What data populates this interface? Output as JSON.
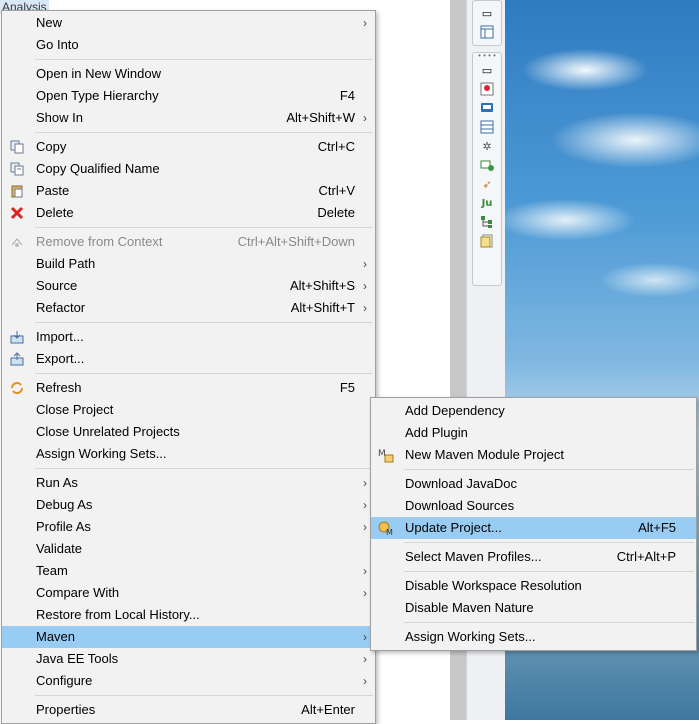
{
  "header": {
    "label": "Analysis"
  },
  "context_menu": {
    "items": [
      {
        "label": "New",
        "arrow": true
      },
      {
        "label": "Go Into"
      },
      {
        "sep": true
      },
      {
        "label": "Open in New Window"
      },
      {
        "label": "Open Type Hierarchy",
        "shortcut": "F4"
      },
      {
        "label": "Show In",
        "shortcut": "Alt+Shift+W",
        "arrow": true
      },
      {
        "sep": true
      },
      {
        "label": "Copy",
        "shortcut": "Ctrl+C",
        "icon": "copy-icon"
      },
      {
        "label": "Copy Qualified Name",
        "icon": "copy-qualified-name-icon"
      },
      {
        "label": "Paste",
        "shortcut": "Ctrl+V",
        "icon": "paste-icon"
      },
      {
        "label": "Delete",
        "shortcut": "Delete",
        "icon": "delete-icon"
      },
      {
        "sep": true
      },
      {
        "label": "Remove from Context",
        "shortcut": "Ctrl+Alt+Shift+Down",
        "icon": "remove-context-icon",
        "disabled": true
      },
      {
        "label": "Build Path",
        "arrow": true
      },
      {
        "label": "Source",
        "shortcut": "Alt+Shift+S",
        "arrow": true
      },
      {
        "label": "Refactor",
        "shortcut": "Alt+Shift+T",
        "arrow": true
      },
      {
        "sep": true
      },
      {
        "label": "Import...",
        "icon": "import-icon"
      },
      {
        "label": "Export...",
        "icon": "export-icon"
      },
      {
        "sep": true
      },
      {
        "label": "Refresh",
        "shortcut": "F5",
        "icon": "refresh-icon"
      },
      {
        "label": "Close Project"
      },
      {
        "label": "Close Unrelated Projects"
      },
      {
        "label": "Assign Working Sets..."
      },
      {
        "sep": true
      },
      {
        "label": "Run As",
        "arrow": true
      },
      {
        "label": "Debug As",
        "arrow": true
      },
      {
        "label": "Profile As",
        "arrow": true
      },
      {
        "label": "Validate"
      },
      {
        "label": "Team",
        "arrow": true
      },
      {
        "label": "Compare With",
        "arrow": true
      },
      {
        "label": "Restore from Local History..."
      },
      {
        "label": "Maven",
        "arrow": true,
        "highlighted": true
      },
      {
        "label": "Java EE Tools",
        "arrow": true
      },
      {
        "label": "Configure",
        "arrow": true
      },
      {
        "sep": true
      },
      {
        "label": "Properties",
        "shortcut": "Alt+Enter"
      }
    ]
  },
  "maven_submenu": {
    "items": [
      {
        "label": "Add Dependency"
      },
      {
        "label": "Add Plugin"
      },
      {
        "label": "New Maven Module Project",
        "icon": "maven-module-icon"
      },
      {
        "sep": true
      },
      {
        "label": "Download JavaDoc"
      },
      {
        "label": "Download Sources"
      },
      {
        "label": "Update Project...",
        "shortcut": "Alt+F5",
        "icon": "maven-update-icon",
        "highlighted": true
      },
      {
        "sep": true
      },
      {
        "label": "Select Maven Profiles...",
        "shortcut": "Ctrl+Alt+P"
      },
      {
        "sep": true
      },
      {
        "label": "Disable Workspace Resolution"
      },
      {
        "label": "Disable Maven Nature"
      },
      {
        "sep": true
      },
      {
        "label": "Assign Working Sets..."
      }
    ]
  },
  "toolbar": {
    "icons": [
      "restore-icon",
      "layout-icon",
      "restore-icon-2",
      "person-view-icon",
      "console-icon",
      "table-view-icon",
      "debug-icon",
      "add-server-icon",
      "rocket-icon",
      "junit-icon",
      "hierarchy-icon",
      "tasks-icon"
    ]
  },
  "colors": {
    "highlight": "#99ccf3",
    "menu_bg": "#f2f2f2",
    "disabled_text": "#8a8a8a"
  }
}
